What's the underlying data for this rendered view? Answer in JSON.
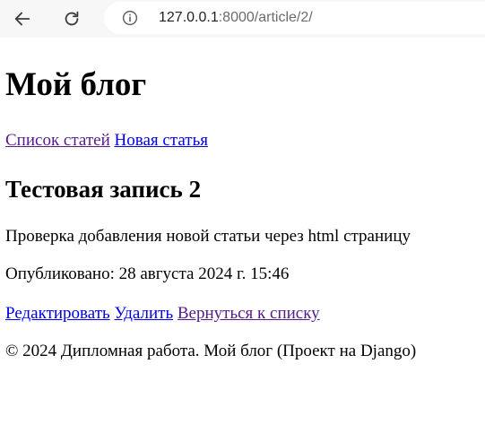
{
  "browser": {
    "url_host": "127.0.0.1",
    "url_rest": ":8000/article/2/"
  },
  "header": {
    "blog_title": "Мой блог",
    "nav": {
      "articles_link": "Список статей",
      "new_article_link": "Новая статья"
    }
  },
  "article": {
    "title": "Тестовая запись 2",
    "body": "Проверка добавления новой статьи через html страницу",
    "published": "Опубликовано: 28 августа 2024 г. 15:46"
  },
  "actions": {
    "edit": "Редактировать",
    "delete": "Удалить",
    "back": "Вернуться к списку"
  },
  "footer": {
    "text": "© 2024 Дипломная работа. Мой блог (Проект на Django)"
  },
  "colors": {
    "link": "#0000ee",
    "visited_link": "#551a8b",
    "toolbar_bg": "#f7f7f7"
  }
}
